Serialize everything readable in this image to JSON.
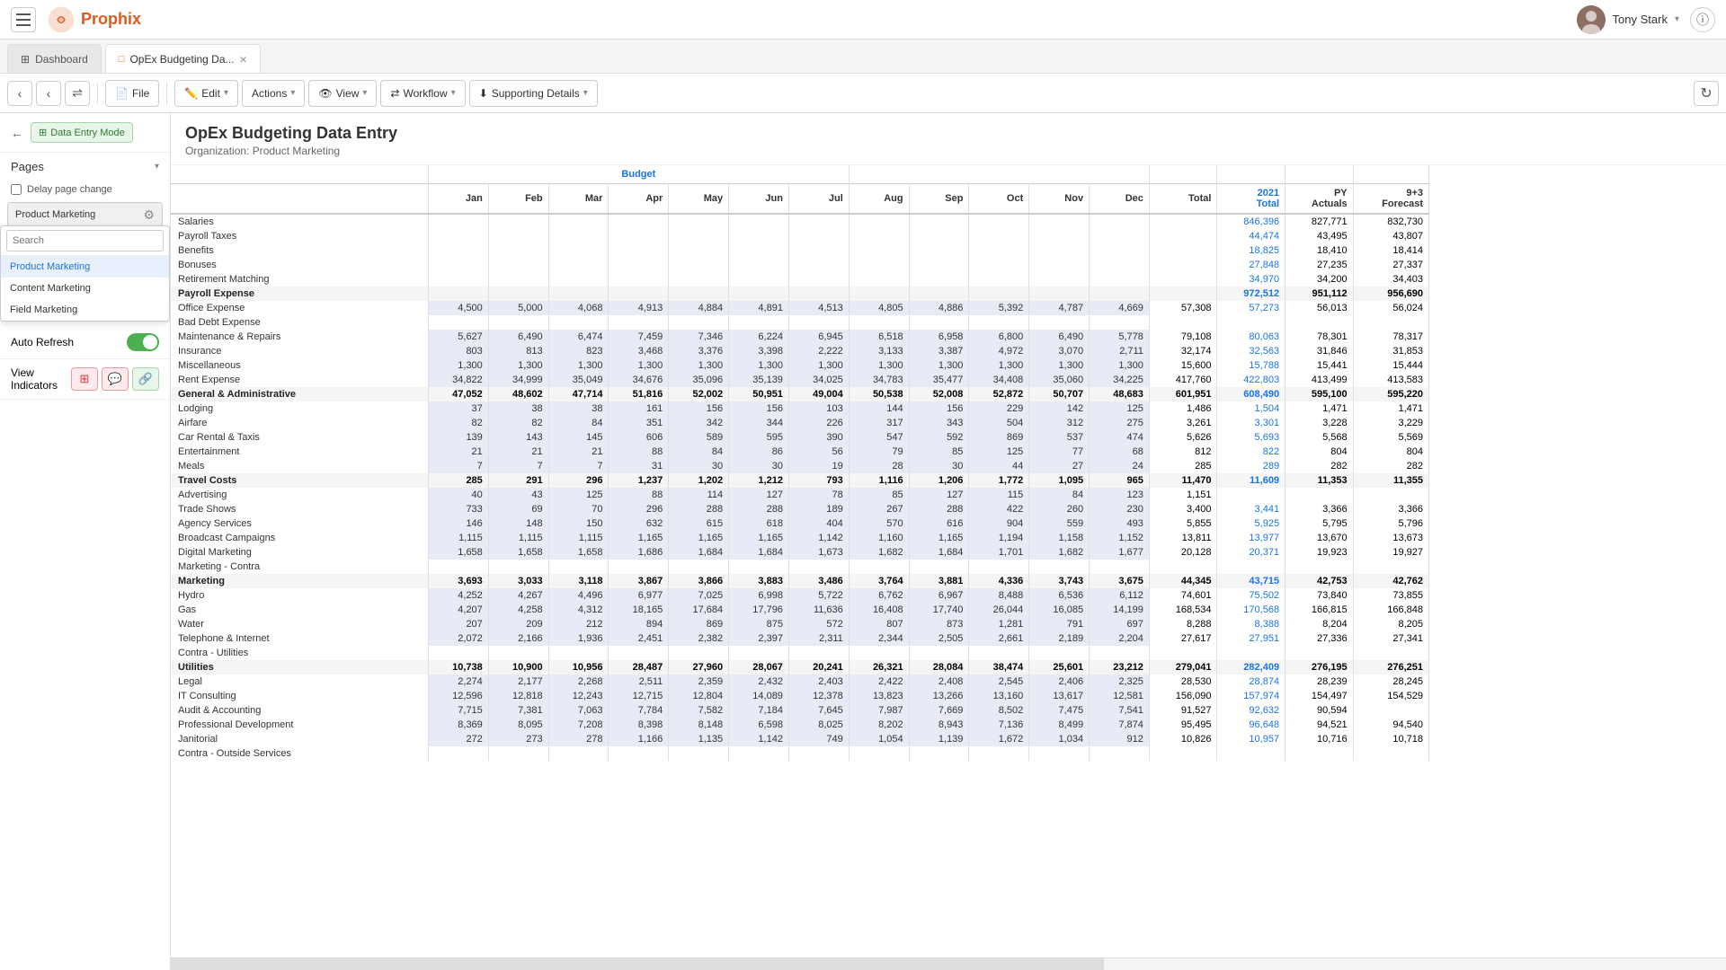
{
  "app": {
    "title": "Prophix",
    "user": "Tony Stark"
  },
  "tabs": [
    {
      "id": "dashboard",
      "label": "Dashboard",
      "active": false,
      "closeable": false
    },
    {
      "id": "opex",
      "label": "OpEx Budgeting Da...",
      "active": true,
      "closeable": true
    }
  ],
  "toolbar": {
    "file_label": "File",
    "edit_label": "Edit",
    "actions_label": "Actions",
    "view_label": "View",
    "workflow_label": "Workflow",
    "supporting_details_label": "Supporting Details"
  },
  "sidebar": {
    "data_entry_mode_label": "Data Entry Mode",
    "pages_label": "Pages",
    "delay_page_change_label": "Delay page change",
    "current_page": "Product Marketing",
    "search_placeholder": "Search",
    "pages": [
      {
        "label": "Product Marketing",
        "selected": true
      },
      {
        "label": "Content Marketing",
        "selected": false
      },
      {
        "label": "Field Marketing",
        "selected": false
      }
    ],
    "auto_refresh_label": "Auto Refresh",
    "auto_refresh_enabled": true,
    "view_indicators_label": "View Indicators"
  },
  "report": {
    "title": "OpEx Budgeting Data Entry",
    "subtitle": "Organization: Product Marketing"
  },
  "table": {
    "col_headers": {
      "group_label": "Budget",
      "months": [
        "Jan",
        "Feb",
        "Mar",
        "Apr",
        "May",
        "Jun",
        "Jul",
        "Aug",
        "Sep",
        "Oct",
        "Nov",
        "Dec"
      ],
      "total_label": "Total",
      "col_2021_label": "2021 Total",
      "py_label": "PY Actuals",
      "col_93_label": "9+3 Forecast"
    },
    "rows": [
      {
        "label": "Salaries",
        "type": "data",
        "values": [
          "",
          "",
          "",
          "",
          "",
          "",
          "",
          "",
          "",
          "",
          "",
          ""
        ],
        "total": "",
        "v2021": "846,396",
        "py": "827,771",
        "fc": "832,730"
      },
      {
        "label": "Payroll Taxes",
        "type": "data",
        "values": [
          "",
          "",
          "",
          "",
          "",
          "",
          "",
          "",
          "",
          "",
          "",
          ""
        ],
        "total": "",
        "v2021": "44,474",
        "py": "43,495",
        "fc": "43,807"
      },
      {
        "label": "Benefits",
        "type": "data",
        "values": [
          "",
          "",
          "",
          "",
          "",
          "",
          "",
          "",
          "",
          "",
          "",
          ""
        ],
        "total": "",
        "v2021": "18,825",
        "py": "18,410",
        "fc": "18,414"
      },
      {
        "label": "Bonuses",
        "type": "data",
        "values": [
          "",
          "",
          "",
          "",
          "",
          "",
          "",
          "",
          "",
          "",
          "",
          ""
        ],
        "total": "",
        "v2021": "27,848",
        "py": "27,235",
        "fc": "27,337"
      },
      {
        "label": "Retirement Matching",
        "type": "data",
        "values": [
          "",
          "",
          "",
          "",
          "",
          "",
          "",
          "",
          "",
          "",
          "",
          ""
        ],
        "total": "",
        "v2021": "34,970",
        "py": "34,200",
        "fc": "34,403"
      },
      {
        "label": "Payroll Expense",
        "type": "subtotal",
        "values": [
          "",
          "",
          "",
          "",
          "",
          "",
          "",
          "",
          "",
          "",
          "",
          ""
        ],
        "total": "",
        "v2021": "972,512",
        "py": "951,112",
        "fc": "956,690"
      },
      {
        "label": "Office Expense",
        "type": "data",
        "values": [
          "4,500",
          "5,000",
          "4,068",
          "4,913",
          "4,884",
          "4,891",
          "4,513",
          "4,805",
          "4,886",
          "5,392",
          "4,787",
          "4,669"
        ],
        "total": "57,308",
        "v2021": "57,273",
        "py": "56,013",
        "fc": "56,024"
      },
      {
        "label": "Bad Debt Expense",
        "type": "data",
        "values": [
          "",
          "",
          "",
          "",
          "",
          "",
          "",
          "",
          "",
          "",
          "",
          ""
        ],
        "total": "",
        "v2021": "",
        "py": "",
        "fc": ""
      },
      {
        "label": "Maintenance & Repairs",
        "type": "data",
        "values": [
          "5,627",
          "6,490",
          "6,474",
          "7,459",
          "7,346",
          "6,224",
          "6,945",
          "6,518",
          "6,958",
          "6,800",
          "6,490",
          "5,778"
        ],
        "total": "79,108",
        "v2021": "80,063",
        "py": "78,301",
        "fc": "78,317"
      },
      {
        "label": "Insurance",
        "type": "data",
        "values": [
          "803",
          "813",
          "823",
          "3,468",
          "3,376",
          "3,398",
          "2,222",
          "3,133",
          "3,387",
          "4,972",
          "3,070",
          "2,711"
        ],
        "total": "32,174",
        "v2021": "32,563",
        "py": "31,846",
        "fc": "31,853"
      },
      {
        "label": "Miscellaneous",
        "type": "data",
        "values": [
          "1,300",
          "1,300",
          "1,300",
          "1,300",
          "1,300",
          "1,300",
          "1,300",
          "1,300",
          "1,300",
          "1,300",
          "1,300",
          "1,300"
        ],
        "total": "15,600",
        "v2021": "15,788",
        "py": "15,441",
        "fc": "15,444"
      },
      {
        "label": "Rent Expense",
        "type": "data",
        "values": [
          "34,822",
          "34,999",
          "35,049",
          "34,676",
          "35,096",
          "35,139",
          "34,025",
          "34,783",
          "35,477",
          "34,408",
          "35,060",
          "34,225"
        ],
        "total": "417,760",
        "v2021": "422,803",
        "py": "413,499",
        "fc": "413,583"
      },
      {
        "label": "General & Administrative",
        "type": "subtotal",
        "values": [
          "47,052",
          "48,602",
          "47,714",
          "51,816",
          "52,002",
          "50,951",
          "49,004",
          "50,538",
          "52,008",
          "52,872",
          "50,707",
          "48,683"
        ],
        "total": "601,951",
        "v2021": "608,490",
        "py": "595,100",
        "fc": "595,220"
      },
      {
        "label": "Lodging",
        "type": "data",
        "values": [
          "37",
          "38",
          "38",
          "161",
          "156",
          "156",
          "103",
          "144",
          "156",
          "229",
          "142",
          "125"
        ],
        "total": "1,486",
        "v2021": "1,504",
        "py": "1,471",
        "fc": "1,471"
      },
      {
        "label": "Airfare",
        "type": "data",
        "values": [
          "82",
          "82",
          "84",
          "351",
          "342",
          "344",
          "226",
          "317",
          "343",
          "504",
          "312",
          "275"
        ],
        "total": "3,261",
        "v2021": "3,301",
        "py": "3,228",
        "fc": "3,229"
      },
      {
        "label": "Car Rental & Taxis",
        "type": "data",
        "values": [
          "139",
          "143",
          "145",
          "606",
          "589",
          "595",
          "390",
          "547",
          "592",
          "869",
          "537",
          "474"
        ],
        "total": "5,626",
        "v2021": "5,693",
        "py": "5,568",
        "fc": "5,569"
      },
      {
        "label": "Entertainment",
        "type": "data",
        "values": [
          "21",
          "21",
          "21",
          "88",
          "84",
          "86",
          "56",
          "79",
          "85",
          "125",
          "77",
          "68"
        ],
        "total": "812",
        "v2021": "822",
        "py": "804",
        "fc": "804"
      },
      {
        "label": "Meals",
        "type": "data",
        "values": [
          "7",
          "7",
          "7",
          "31",
          "30",
          "30",
          "19",
          "28",
          "30",
          "44",
          "27",
          "24"
        ],
        "total": "285",
        "v2021": "289",
        "py": "282",
        "fc": "282"
      },
      {
        "label": "Travel Costs",
        "type": "subtotal",
        "values": [
          "285",
          "291",
          "296",
          "1,237",
          "1,202",
          "1,212",
          "793",
          "1,116",
          "1,206",
          "1,772",
          "1,095",
          "965"
        ],
        "total": "11,470",
        "v2021": "11,609",
        "py": "11,353",
        "fc": "11,355"
      },
      {
        "label": "Advertising",
        "type": "data",
        "values": [
          "40",
          "43",
          "125",
          "88",
          "114",
          "127",
          "78",
          "85",
          "127",
          "115",
          "84",
          "123"
        ],
        "total": "1,151",
        "v2021": "",
        "py": "",
        "fc": ""
      },
      {
        "label": "Trade Shows",
        "type": "data",
        "values": [
          "733",
          "69",
          "70",
          "296",
          "288",
          "288",
          "189",
          "267",
          "288",
          "422",
          "260",
          "230"
        ],
        "total": "3,400",
        "v2021": "3,441",
        "py": "3,366",
        "fc": "3,366"
      },
      {
        "label": "Agency Services",
        "type": "data",
        "values": [
          "146",
          "148",
          "150",
          "632",
          "615",
          "618",
          "404",
          "570",
          "616",
          "904",
          "559",
          "493"
        ],
        "total": "5,855",
        "v2021": "5,925",
        "py": "5,795",
        "fc": "5,796"
      },
      {
        "label": "Broadcast Campaigns",
        "type": "data",
        "values": [
          "1,115",
          "1,115",
          "1,115",
          "1,165",
          "1,165",
          "1,165",
          "1,142",
          "1,160",
          "1,165",
          "1,194",
          "1,158",
          "1,152"
        ],
        "total": "13,811",
        "v2021": "13,977",
        "py": "13,670",
        "fc": "13,673"
      },
      {
        "label": "Digital Marketing",
        "type": "data",
        "values": [
          "1,658",
          "1,658",
          "1,658",
          "1,686",
          "1,684",
          "1,684",
          "1,673",
          "1,682",
          "1,684",
          "1,701",
          "1,682",
          "1,677"
        ],
        "total": "20,128",
        "v2021": "20,371",
        "py": "19,923",
        "fc": "19,927"
      },
      {
        "label": "Marketing - Contra",
        "type": "data",
        "values": [
          "",
          "",
          "",
          "",
          "",
          "",
          "",
          "",
          "",
          "",
          "",
          ""
        ],
        "total": "",
        "v2021": "",
        "py": "",
        "fc": ""
      },
      {
        "label": "Marketing",
        "type": "subtotal",
        "values": [
          "3,693",
          "3,033",
          "3,118",
          "3,867",
          "3,866",
          "3,883",
          "3,486",
          "3,764",
          "3,881",
          "4,336",
          "3,743",
          "3,675"
        ],
        "total": "44,345",
        "v2021": "43,715",
        "py": "42,753",
        "fc": "42,762"
      },
      {
        "label": "Hydro",
        "type": "data",
        "values": [
          "4,252",
          "4,267",
          "4,496",
          "6,977",
          "7,025",
          "6,998",
          "5,722",
          "6,762",
          "6,967",
          "8,488",
          "6,536",
          "6,112"
        ],
        "total": "74,601",
        "v2021": "75,502",
        "py": "73,840",
        "fc": "73,855"
      },
      {
        "label": "Gas",
        "type": "data",
        "values": [
          "4,207",
          "4,258",
          "4,312",
          "18,165",
          "17,684",
          "17,796",
          "11,636",
          "16,408",
          "17,740",
          "26,044",
          "16,085",
          "14,199"
        ],
        "total": "168,534",
        "v2021": "170,568",
        "py": "166,815",
        "fc": "166,848"
      },
      {
        "label": "Water",
        "type": "data",
        "values": [
          "207",
          "209",
          "212",
          "894",
          "869",
          "875",
          "572",
          "807",
          "873",
          "1,281",
          "791",
          "697"
        ],
        "total": "8,288",
        "v2021": "8,388",
        "py": "8,204",
        "fc": "8,205"
      },
      {
        "label": "Telephone & Internet",
        "type": "data",
        "values": [
          "2,072",
          "2,166",
          "1,936",
          "2,451",
          "2,382",
          "2,397",
          "2,311",
          "2,344",
          "2,505",
          "2,661",
          "2,189",
          "2,204"
        ],
        "total": "27,617",
        "v2021": "27,951",
        "py": "27,336",
        "fc": "27,341"
      },
      {
        "label": "Contra - Utilities",
        "type": "data",
        "values": [
          "",
          "",
          "",
          "",
          "",
          "",
          "",
          "",
          "",
          "",
          "",
          ""
        ],
        "total": "",
        "v2021": "",
        "py": "",
        "fc": ""
      },
      {
        "label": "Utilities",
        "type": "subtotal",
        "values": [
          "10,738",
          "10,900",
          "10,956",
          "28,487",
          "27,960",
          "28,067",
          "20,241",
          "26,321",
          "28,084",
          "38,474",
          "25,601",
          "23,212"
        ],
        "total": "279,041",
        "v2021": "282,409",
        "py": "276,195",
        "fc": "276,251"
      },
      {
        "label": "Legal",
        "type": "data",
        "values": [
          "2,274",
          "2,177",
          "2,268",
          "2,511",
          "2,359",
          "2,432",
          "2,403",
          "2,422",
          "2,408",
          "2,545",
          "2,406",
          "2,325"
        ],
        "total": "28,530",
        "v2021": "28,874",
        "py": "28,239",
        "fc": "28,245"
      },
      {
        "label": "IT Consulting",
        "type": "data",
        "values": [
          "12,596",
          "12,818",
          "12,243",
          "12,715",
          "12,804",
          "14,089",
          "12,378",
          "13,823",
          "13,266",
          "13,160",
          "13,617",
          "12,581"
        ],
        "total": "156,090",
        "v2021": "157,974",
        "py": "154,497",
        "fc": "154,529"
      },
      {
        "label": "Audit & Accounting",
        "type": "data",
        "values": [
          "7,715",
          "7,381",
          "7,063",
          "7,784",
          "7,582",
          "7,184",
          "7,645",
          "7,987",
          "7,669",
          "8,502",
          "7,475",
          "7,541"
        ],
        "total": "91,527",
        "v2021": "92,632",
        "py": "90,594",
        "fc": ""
      },
      {
        "label": "Professional Development",
        "type": "data",
        "values": [
          "8,369",
          "8,095",
          "7,208",
          "8,398",
          "8,148",
          "6,598",
          "8,025",
          "8,202",
          "8,943",
          "7,136",
          "8,499",
          "7,874"
        ],
        "total": "95,495",
        "v2021": "96,648",
        "py": "94,521",
        "fc": "94,540"
      },
      {
        "label": "Janitorial",
        "type": "data",
        "values": [
          "272",
          "273",
          "278",
          "1,166",
          "1,135",
          "1,142",
          "749",
          "1,054",
          "1,139",
          "1,672",
          "1,034",
          "912"
        ],
        "total": "10,826",
        "v2021": "10,957",
        "py": "10,716",
        "fc": "10,718"
      },
      {
        "label": "Contra - Outside Services",
        "type": "data",
        "values": [
          "",
          "",
          "",
          "",
          "",
          "",
          "",
          "",
          "",
          "",
          "",
          ""
        ],
        "total": "",
        "v2021": "",
        "py": "",
        "fc": ""
      }
    ]
  }
}
